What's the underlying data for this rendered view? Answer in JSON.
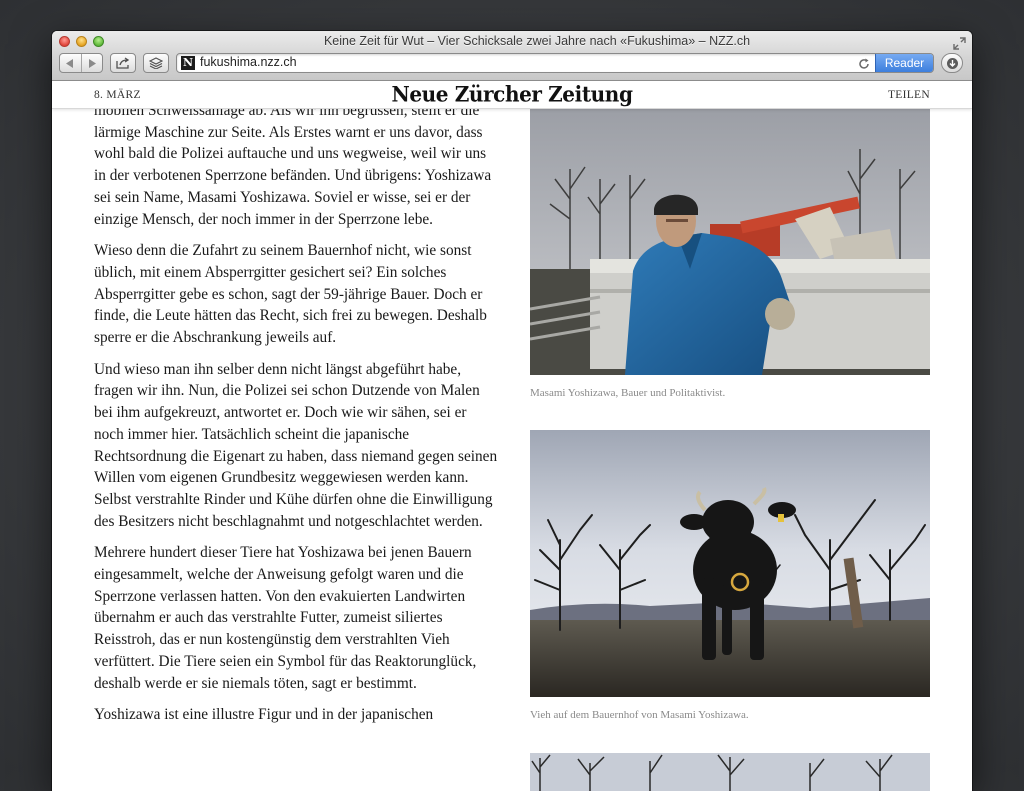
{
  "window": {
    "title": "Keine Zeit für Wut – Vier Schicksale zwei Jahre nach «Fukushima» – NZZ.ch"
  },
  "toolbar": {
    "url": "fukushima.nzz.ch",
    "reader_label": "Reader",
    "favicon_letter": "N",
    "icons": [
      "back-icon",
      "forward-icon",
      "share-icon",
      "reading-list-icon",
      "reload-icon",
      "download-icon",
      "fullscreen-icon"
    ]
  },
  "header": {
    "date": "8. MÄRZ",
    "logo": "Neue Zürcher Zeitung",
    "share_label": "TEILEN"
  },
  "article": {
    "paragraphs": [
      "mobilen Schweissanlage ab. Als wir ihn begrüssen, stellt er die lärmige Maschine zur Seite. Als Erstes warnt er uns davor, dass wohl bald die Polizei auftauche und uns wegweise, weil wir uns in der verbotenen Sperrzone befänden. Und übrigens: Yoshizawa sei sein Name, Masami Yoshizawa. Soviel er wisse, sei er der einzige Mensch, der noch immer in der Sperrzone lebe.",
      "Wieso denn die Zufahrt zu seinem Bauernhof nicht, wie sonst üblich, mit einem Absperrgitter gesichert sei? Ein solches Absperrgitter gebe es schon, sagt der 59-jährige Bauer. Doch er finde, die Leute hätten das Recht, sich frei zu bewegen. Deshalb sperre er die Abschrankung jeweils auf.",
      "Und wieso man ihn selber denn nicht längst abgeführt habe, fragen wir ihn. Nun, die Polizei sei schon Dutzende von Malen bei ihm aufgekreuzt, antwortet er. Doch wie wir sähen, sei er noch immer hier. Tatsächlich scheint die japanische Rechtsordnung die Eigenart zu haben, dass niemand gegen seinen Willen vom eigenen Grundbesitz weggewiesen werden kann. Selbst verstrahlte Rinder und Kühe dürfen ohne die Einwilligung des Besitzers nicht beschlagnahmt und notgeschlachtet werden.",
      "Mehrere hundert dieser Tiere hat Yoshizawa bei jenen Bauern eingesammelt, welche der Anweisung gefolgt waren und die Sperrzone verlassen hatten. Von den evakuierten Landwirten übernahm er auch das verstrahlte Futter, zumeist siliertes Reisstroh, das er nun kostengünstig dem verstrahlten Vieh verfüttert. Die Tiere seien ein Symbol für das Reaktorunglück, deshalb werde er sie niemals töten, sagt er bestimmt.",
      "Yoshizawa ist eine illustre Figur und in der japanischen"
    ]
  },
  "photos": [
    {
      "caption": "Masami Yoshizawa, Bauer und Politaktivist.",
      "subject": "farmer"
    },
    {
      "caption": "Vieh auf dem Bauernhof von Masami Yoshizawa.",
      "subject": "cow"
    },
    {
      "caption": "",
      "subject": "trees"
    }
  ],
  "colors": {
    "reader_button": "#4a8ae6",
    "jacket_blue": "#1f5f98",
    "sky_grey": "#c9ccd1"
  }
}
